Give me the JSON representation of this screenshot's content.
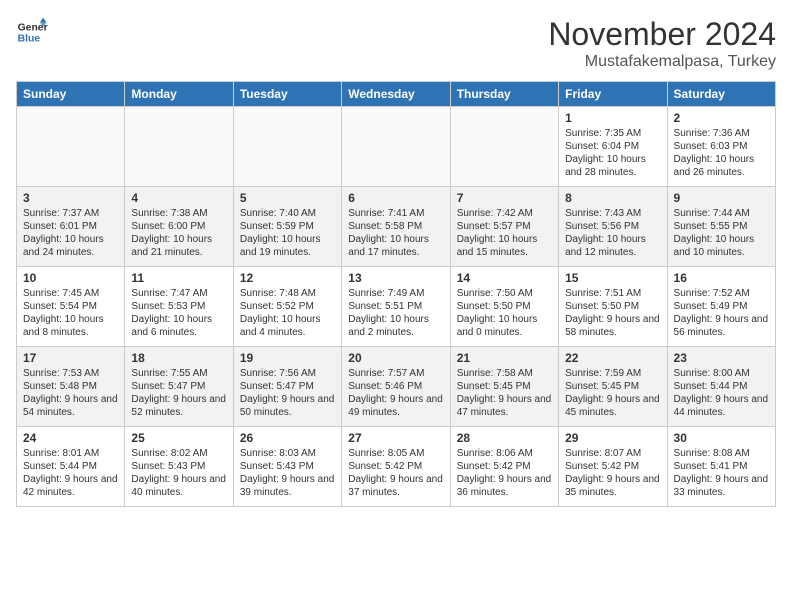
{
  "header": {
    "logo_line1": "General",
    "logo_line2": "Blue",
    "month": "November 2024",
    "location": "Mustafakemalpasa, Turkey"
  },
  "days_of_week": [
    "Sunday",
    "Monday",
    "Tuesday",
    "Wednesday",
    "Thursday",
    "Friday",
    "Saturday"
  ],
  "weeks": [
    [
      {
        "day": "",
        "info": ""
      },
      {
        "day": "",
        "info": ""
      },
      {
        "day": "",
        "info": ""
      },
      {
        "day": "",
        "info": ""
      },
      {
        "day": "",
        "info": ""
      },
      {
        "day": "1",
        "info": "Sunrise: 7:35 AM\nSunset: 6:04 PM\nDaylight: 10 hours and 28 minutes."
      },
      {
        "day": "2",
        "info": "Sunrise: 7:36 AM\nSunset: 6:03 PM\nDaylight: 10 hours and 26 minutes."
      }
    ],
    [
      {
        "day": "3",
        "info": "Sunrise: 7:37 AM\nSunset: 6:01 PM\nDaylight: 10 hours and 24 minutes."
      },
      {
        "day": "4",
        "info": "Sunrise: 7:38 AM\nSunset: 6:00 PM\nDaylight: 10 hours and 21 minutes."
      },
      {
        "day": "5",
        "info": "Sunrise: 7:40 AM\nSunset: 5:59 PM\nDaylight: 10 hours and 19 minutes."
      },
      {
        "day": "6",
        "info": "Sunrise: 7:41 AM\nSunset: 5:58 PM\nDaylight: 10 hours and 17 minutes."
      },
      {
        "day": "7",
        "info": "Sunrise: 7:42 AM\nSunset: 5:57 PM\nDaylight: 10 hours and 15 minutes."
      },
      {
        "day": "8",
        "info": "Sunrise: 7:43 AM\nSunset: 5:56 PM\nDaylight: 10 hours and 12 minutes."
      },
      {
        "day": "9",
        "info": "Sunrise: 7:44 AM\nSunset: 5:55 PM\nDaylight: 10 hours and 10 minutes."
      }
    ],
    [
      {
        "day": "10",
        "info": "Sunrise: 7:45 AM\nSunset: 5:54 PM\nDaylight: 10 hours and 8 minutes."
      },
      {
        "day": "11",
        "info": "Sunrise: 7:47 AM\nSunset: 5:53 PM\nDaylight: 10 hours and 6 minutes."
      },
      {
        "day": "12",
        "info": "Sunrise: 7:48 AM\nSunset: 5:52 PM\nDaylight: 10 hours and 4 minutes."
      },
      {
        "day": "13",
        "info": "Sunrise: 7:49 AM\nSunset: 5:51 PM\nDaylight: 10 hours and 2 minutes."
      },
      {
        "day": "14",
        "info": "Sunrise: 7:50 AM\nSunset: 5:50 PM\nDaylight: 10 hours and 0 minutes."
      },
      {
        "day": "15",
        "info": "Sunrise: 7:51 AM\nSunset: 5:50 PM\nDaylight: 9 hours and 58 minutes."
      },
      {
        "day": "16",
        "info": "Sunrise: 7:52 AM\nSunset: 5:49 PM\nDaylight: 9 hours and 56 minutes."
      }
    ],
    [
      {
        "day": "17",
        "info": "Sunrise: 7:53 AM\nSunset: 5:48 PM\nDaylight: 9 hours and 54 minutes."
      },
      {
        "day": "18",
        "info": "Sunrise: 7:55 AM\nSunset: 5:47 PM\nDaylight: 9 hours and 52 minutes."
      },
      {
        "day": "19",
        "info": "Sunrise: 7:56 AM\nSunset: 5:47 PM\nDaylight: 9 hours and 50 minutes."
      },
      {
        "day": "20",
        "info": "Sunrise: 7:57 AM\nSunset: 5:46 PM\nDaylight: 9 hours and 49 minutes."
      },
      {
        "day": "21",
        "info": "Sunrise: 7:58 AM\nSunset: 5:45 PM\nDaylight: 9 hours and 47 minutes."
      },
      {
        "day": "22",
        "info": "Sunrise: 7:59 AM\nSunset: 5:45 PM\nDaylight: 9 hours and 45 minutes."
      },
      {
        "day": "23",
        "info": "Sunrise: 8:00 AM\nSunset: 5:44 PM\nDaylight: 9 hours and 44 minutes."
      }
    ],
    [
      {
        "day": "24",
        "info": "Sunrise: 8:01 AM\nSunset: 5:44 PM\nDaylight: 9 hours and 42 minutes."
      },
      {
        "day": "25",
        "info": "Sunrise: 8:02 AM\nSunset: 5:43 PM\nDaylight: 9 hours and 40 minutes."
      },
      {
        "day": "26",
        "info": "Sunrise: 8:03 AM\nSunset: 5:43 PM\nDaylight: 9 hours and 39 minutes."
      },
      {
        "day": "27",
        "info": "Sunrise: 8:05 AM\nSunset: 5:42 PM\nDaylight: 9 hours and 37 minutes."
      },
      {
        "day": "28",
        "info": "Sunrise: 8:06 AM\nSunset: 5:42 PM\nDaylight: 9 hours and 36 minutes."
      },
      {
        "day": "29",
        "info": "Sunrise: 8:07 AM\nSunset: 5:42 PM\nDaylight: 9 hours and 35 minutes."
      },
      {
        "day": "30",
        "info": "Sunrise: 8:08 AM\nSunset: 5:41 PM\nDaylight: 9 hours and 33 minutes."
      }
    ]
  ]
}
